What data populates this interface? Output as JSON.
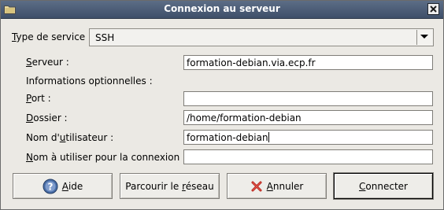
{
  "window": {
    "title": "Connexion au serveur"
  },
  "service": {
    "label": "Type de service :",
    "value": "SSH"
  },
  "fields": {
    "server": {
      "label": "Serveur :",
      "value": "formation-debian.via.ecp.fr"
    },
    "optional_header": "Informations optionnelles :",
    "port": {
      "label": "Port :",
      "value": ""
    },
    "folder": {
      "label": "Dossier :",
      "value": "/home/formation-debian"
    },
    "username": {
      "label": "Nom d'utilisateur :",
      "value": "formation-debian"
    },
    "connection_name": {
      "label": "Nom à utiliser pour la connexion :",
      "value": ""
    }
  },
  "buttons": {
    "help": "Aide",
    "browse": "Parcourir le réseau",
    "cancel": "Annuler",
    "connect": "Connecter"
  },
  "icons": {
    "window": "folder-icon",
    "close": "close-icon",
    "dropdown": "chevron-down-icon",
    "help": "help-icon",
    "cancel": "cancel-icon"
  }
}
